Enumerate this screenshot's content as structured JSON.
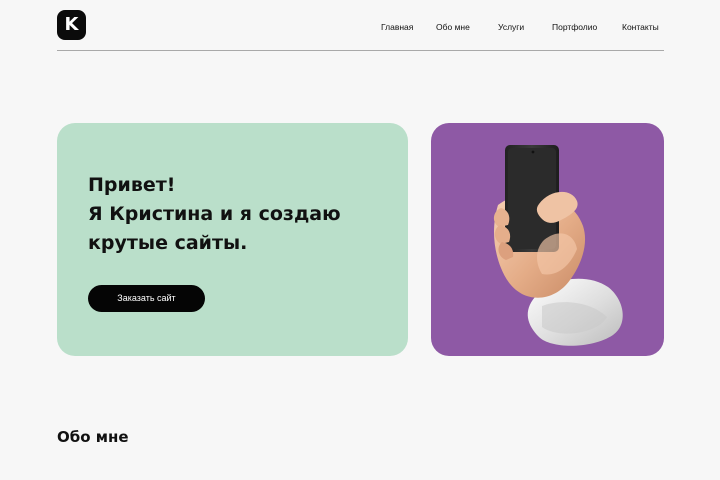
{
  "brand": {
    "logo_letter": "K"
  },
  "nav": {
    "items": [
      {
        "label": "Главная"
      },
      {
        "label": "Обо мне"
      },
      {
        "label": "Услуги"
      },
      {
        "label": "Портфолио"
      },
      {
        "label": "Контакты"
      }
    ]
  },
  "hero": {
    "title_lines": [
      "Привет!",
      "Я Кристина и я создаю",
      "крутые сайты."
    ],
    "button_label": "Заказать сайт",
    "image_icon": "hand-holding-phone-icon"
  },
  "about": {
    "title": "Обо мне"
  },
  "colors": {
    "background": "#f7f7f7",
    "hero_card": "#badfca",
    "image_card": "#8e59a5",
    "button": "#050505"
  }
}
